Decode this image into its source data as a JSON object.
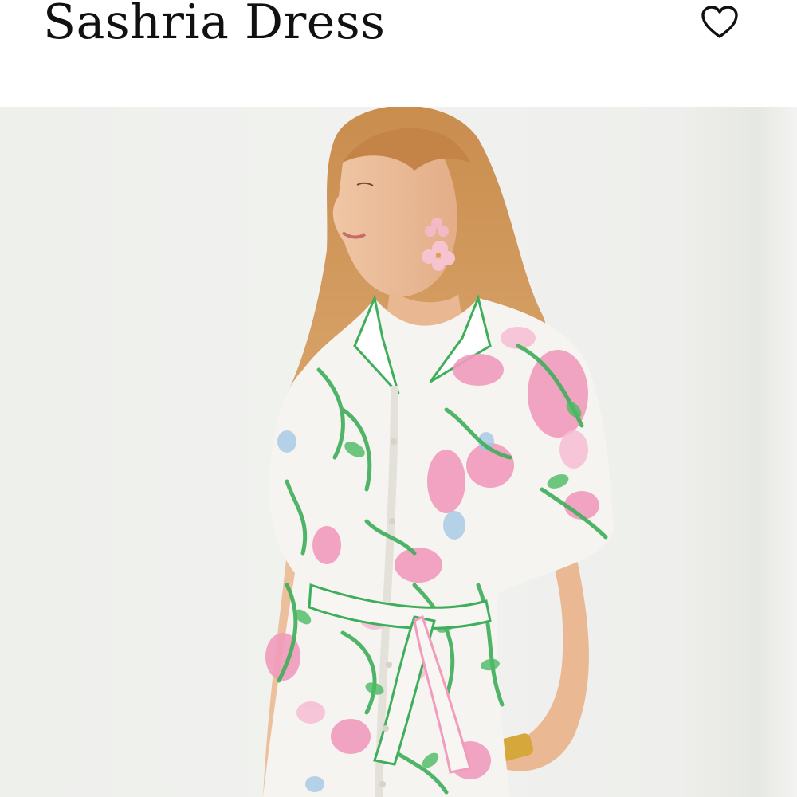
{
  "product": {
    "title": "Sashria Dress",
    "wishlist_icon": "heart-outline-icon",
    "image_subject": "model-in-floral-shirt-dress"
  },
  "colors": {
    "text": "#111111",
    "background": "#ffffff",
    "photo_backdrop": "#eef0ec",
    "print_green": "#3fae5a",
    "print_pink": "#f08fb2"
  }
}
